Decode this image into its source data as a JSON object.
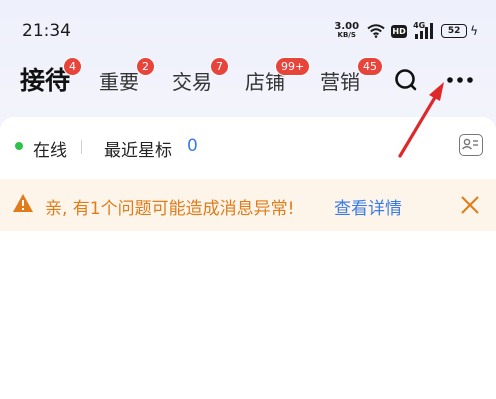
{
  "status_bar": {
    "time": "21:34",
    "net_speed_value": "3.00",
    "net_speed_unit": "KB/S",
    "hd_label": "HD",
    "signal_label": "4G",
    "battery": "52"
  },
  "tabs": [
    {
      "label": "接待",
      "badge": "4",
      "active": true
    },
    {
      "label": "重要",
      "badge": "2"
    },
    {
      "label": "交易",
      "badge": "7"
    },
    {
      "label": "店铺",
      "badge": "99+"
    },
    {
      "label": "营销",
      "badge": "45"
    }
  ],
  "status": {
    "online_label": "在线",
    "starred_label": "最近星标",
    "starred_count": "0"
  },
  "warning": {
    "message": "亲, 有1个问题可能造成消息异常!",
    "link_label": "查看详情"
  },
  "colors": {
    "badge": "#e7453b",
    "online": "#2ec24a",
    "link": "#3b7be8",
    "warning_text": "#e07c1c",
    "warning_bg": "#fdf5ea",
    "annotation_arrow": "#e0282b"
  }
}
